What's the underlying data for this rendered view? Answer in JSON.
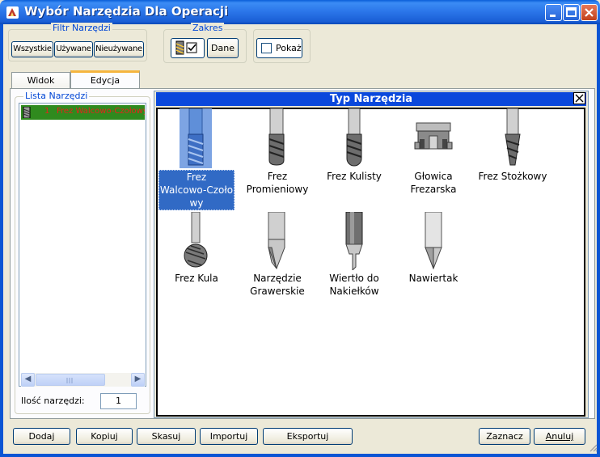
{
  "window": {
    "title": "Wybór Narzędzia Dla Operacji",
    "controls": [
      "minimize",
      "maximize",
      "close"
    ]
  },
  "filter_group": {
    "title": "Filtr Narzędzi",
    "buttons": [
      "Wszystkie",
      "Używane",
      "Nieużywane"
    ]
  },
  "range_group": {
    "title": "Zakres",
    "dane_label": "Dane"
  },
  "show_group": {
    "checkbox_label": "Pokaż",
    "checked": false
  },
  "tabs": [
    {
      "label": "Widok",
      "active": false
    },
    {
      "label": "Edycja",
      "active": true
    }
  ],
  "tool_list": {
    "title": "Lista  Narzędzi",
    "items": [
      {
        "number": "1",
        "label": "Frez Walcowo-Czołowy",
        "selected": true
      }
    ],
    "count_label": "Ilość narzędzi:",
    "count_value": "1"
  },
  "tool_type_panel": {
    "title": "Typ Narzędzia",
    "tools": [
      {
        "label": "Frez\nWalcowo-Czoło\nwy",
        "icon": "end-mill-icon",
        "selected": true
      },
      {
        "label": "Frez\nPromieniowy",
        "icon": "radius-mill-icon",
        "selected": false
      },
      {
        "label": "Frez Kulisty",
        "icon": "ball-mill-icon",
        "selected": false
      },
      {
        "label": "Głowica\nFrezarska",
        "icon": "face-mill-head-icon",
        "selected": false
      },
      {
        "label": "Frez Stożkowy",
        "icon": "taper-mill-icon",
        "selected": false
      },
      {
        "label": "Frez Kula",
        "icon": "ball-cutter-icon",
        "selected": false
      },
      {
        "label": "Narzędzie\nGrawerskie",
        "icon": "engraving-tool-icon",
        "selected": false
      },
      {
        "label": "Wiertło do\nNakiełków",
        "icon": "center-drill-icon",
        "selected": false
      },
      {
        "label": "Nawiertak",
        "icon": "spot-drill-icon",
        "selected": false
      }
    ]
  },
  "bottom_buttons": {
    "add": "Dodaj",
    "copy": "Kopiuj",
    "delete": "Skasuj",
    "import": "Importuj",
    "export": "Eksportuj",
    "mark": "Zaznacz",
    "cancel": "Anuluj"
  },
  "colors": {
    "title_bar": "#2a74e8",
    "panel_header": "#0a48dc",
    "selection": "#316ac5",
    "list_item_bg": "#2f8a1e",
    "list_item_text": "#e8211b",
    "group_title": "#0046d5"
  }
}
